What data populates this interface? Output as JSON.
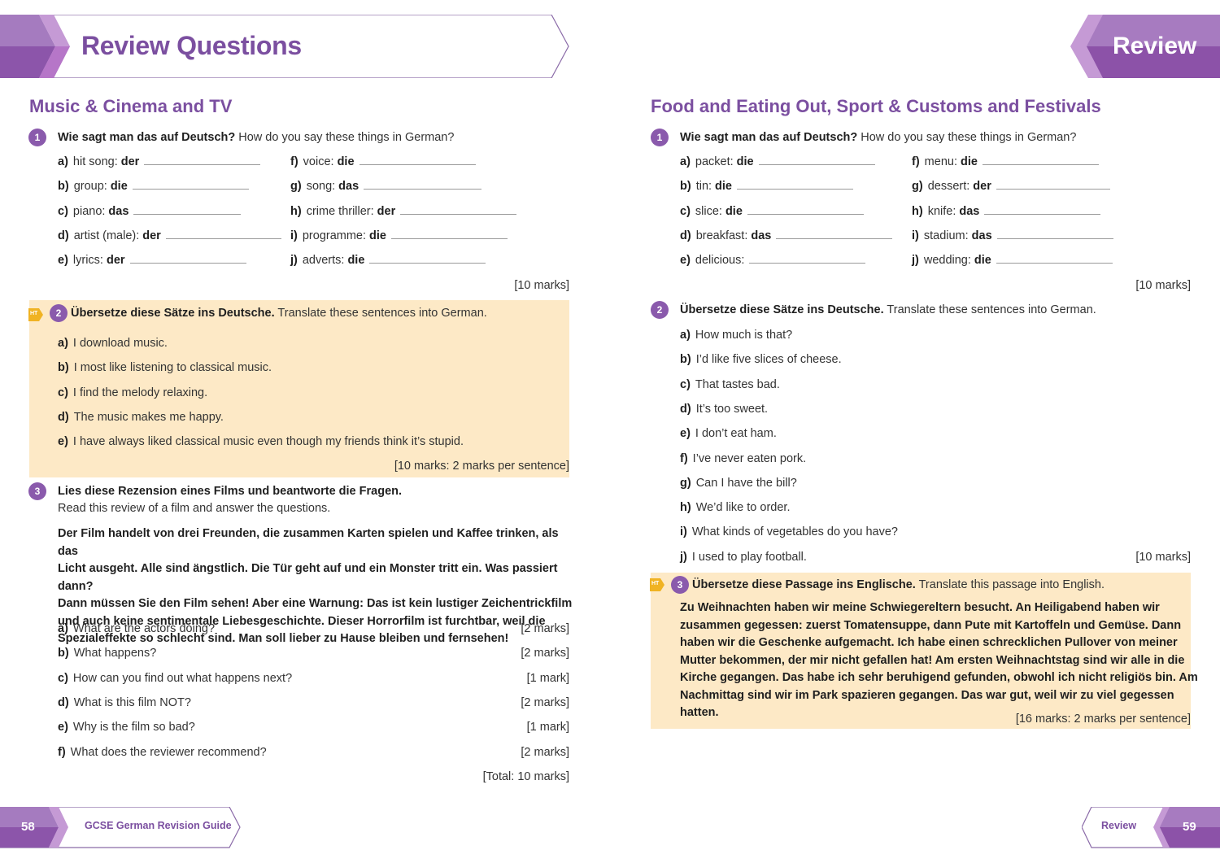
{
  "header": {
    "left_title": "Review Questions",
    "right_title": "Review"
  },
  "footer": {
    "left_page": "58",
    "left_label": "GCSE German Revision Guide",
    "right_label": "Review",
    "right_page": "59"
  },
  "colors": {
    "brand_purple": "#7b4fa0",
    "highlight_bg": "#fde9c6",
    "ht_badge": "#f0b323"
  },
  "left": {
    "section_title": "Music & Cinema and TV",
    "q1": {
      "number": "1",
      "de": "Wie sagt man das auf Deutsch?",
      "en": "How do you say these things in German?",
      "items": [
        {
          "letter": "a)",
          "text": "hit song:",
          "article": "der"
        },
        {
          "letter": "b)",
          "text": "group:",
          "article": "die"
        },
        {
          "letter": "c)",
          "text": "piano:",
          "article": "das"
        },
        {
          "letter": "d)",
          "text": "artist (male):",
          "article": "der"
        },
        {
          "letter": "e)",
          "text": "lyrics:",
          "article": "der"
        },
        {
          "letter": "f)",
          "text": "voice:",
          "article": "die"
        },
        {
          "letter": "g)",
          "text": "song:",
          "article": "das"
        },
        {
          "letter": "h)",
          "text": "crime thriller:",
          "article": "der"
        },
        {
          "letter": "i)",
          "text": "programme:",
          "article": "die"
        },
        {
          "letter": "j)",
          "text": "adverts:",
          "article": "die"
        }
      ],
      "marks": "[10 marks]"
    },
    "q2": {
      "badge": "HT",
      "number": "2",
      "de": "Übersetze diese Sätze ins Deutsche.",
      "en": "Translate these sentences into German.",
      "items": [
        {
          "letter": "a)",
          "text": "I download music."
        },
        {
          "letter": "b)",
          "text": "I most like listening to classical music."
        },
        {
          "letter": "c)",
          "text": "I find the melody relaxing."
        },
        {
          "letter": "d)",
          "text": "The music makes me happy."
        },
        {
          "letter": "e)",
          "text": "I have always liked classical music even though my friends think it’s stupid."
        }
      ],
      "marks": "[10 marks: 2 marks per sentence]"
    },
    "q3": {
      "number": "3",
      "de": "Lies diese Rezension eines Films und beantworte die Fragen.",
      "en": "Read this review of a film and answer the questions.",
      "passage_lines": [
        "Der Film handelt von drei Freunden, die zusammen Karten spielen und Kaffee trinken, als das",
        "Licht ausgeht. Alle sind ängstlich. Die Tür geht auf und ein Monster tritt ein. Was passiert dann?",
        "Dann müssen Sie den Film sehen! Aber eine Warnung: Das ist kein lustiger Zeichentrickfilm",
        "und auch keine sentimentale Liebesgeschichte. Dieser Horrorfilm ist furchtbar, weil die",
        "Spezialeffekte so schlecht sind. Man soll lieber zu Hause bleiben und fernsehen!"
      ],
      "items": [
        {
          "letter": "a)",
          "text": "What are the actors doing?",
          "marks": "[2 marks]"
        },
        {
          "letter": "b)",
          "text": "What happens?",
          "marks": "[2 marks]"
        },
        {
          "letter": "c)",
          "text": "How can you find out what happens next?",
          "marks": "[1 mark]"
        },
        {
          "letter": "d)",
          "text": "What is this film NOT?",
          "marks": "[2 marks]"
        },
        {
          "letter": "e)",
          "text": "Why is the film so bad?",
          "marks": "[1 mark]"
        },
        {
          "letter": "f)",
          "text": "What does the reviewer recommend?",
          "marks": "[2 marks]"
        }
      ],
      "total": "[Total: 10 marks]"
    }
  },
  "right": {
    "section_title": "Food and Eating Out, Sport & Customs and Festivals",
    "q1": {
      "number": "1",
      "de": "Wie sagt man das auf Deutsch?",
      "en": "How do you say these things in German?",
      "items": [
        {
          "letter": "a)",
          "text": "packet:",
          "article": "die"
        },
        {
          "letter": "b)",
          "text": "tin:",
          "article": "die"
        },
        {
          "letter": "c)",
          "text": "slice:",
          "article": "die"
        },
        {
          "letter": "d)",
          "text": "breakfast:",
          "article": "das"
        },
        {
          "letter": "e)",
          "text": "delicious:",
          "article": ""
        },
        {
          "letter": "f)",
          "text": "menu:",
          "article": "die"
        },
        {
          "letter": "g)",
          "text": "dessert:",
          "article": "der"
        },
        {
          "letter": "h)",
          "text": "knife:",
          "article": "das"
        },
        {
          "letter": "i)",
          "text": "stadium:",
          "article": "das"
        },
        {
          "letter": "j)",
          "text": "wedding:",
          "article": "die"
        }
      ],
      "marks": "[10 marks]"
    },
    "q2": {
      "number": "2",
      "de": "Übersetze diese Sätze ins Deutsche.",
      "en": "Translate these sentences into German.",
      "items": [
        {
          "letter": "a)",
          "text": "How much is that?"
        },
        {
          "letter": "b)",
          "text": "I’d like five slices of cheese."
        },
        {
          "letter": "c)",
          "text": "That tastes bad."
        },
        {
          "letter": "d)",
          "text": "It’s too sweet."
        },
        {
          "letter": "e)",
          "text": "I don’t eat ham."
        },
        {
          "letter": "f)",
          "text": "I’ve never eaten pork."
        },
        {
          "letter": "g)",
          "text": "Can I have the bill?"
        },
        {
          "letter": "h)",
          "text": "We’d like to order."
        },
        {
          "letter": "i)",
          "text": "What kinds of vegetables do you have?"
        },
        {
          "letter": "j)",
          "text": "I used to play football."
        }
      ],
      "marks": "[10 marks]"
    },
    "q3": {
      "badge": "HT",
      "number": "3",
      "de": "Übersetze diese Passage ins Englische.",
      "en": "Translate this passage into English.",
      "passage_lines": [
        "Zu Weihnachten haben wir meine Schwiegereltern besucht. An Heiligabend haben wir",
        "zusammen gegessen: zuerst Tomatensuppe, dann Pute mit Kartoffeln und Gemüse. Dann",
        "haben wir die Geschenke aufgemacht. Ich habe einen schrecklichen Pullover von meiner",
        "Mutter bekommen, der mir nicht gefallen hat! Am ersten Weihnachtstag sind wir alle in die",
        "Kirche gegangen. Das habe ich sehr beruhigend gefunden, obwohl ich nicht religiös bin. Am",
        "Nachmittag sind wir im Park spazieren gegangen. Das war gut, weil wir zu viel gegessen hatten."
      ],
      "marks": "[16 marks: 2 marks per sentence]"
    }
  }
}
